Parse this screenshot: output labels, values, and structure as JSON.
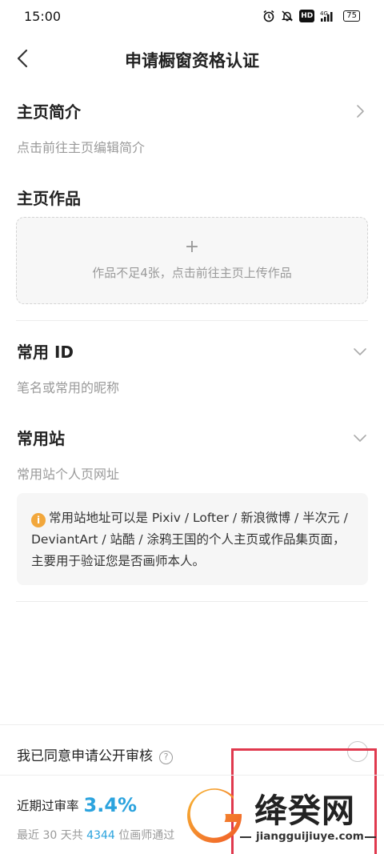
{
  "status_bar": {
    "time": "15:00",
    "network": "4G",
    "hd": "HD",
    "battery": "75"
  },
  "nav": {
    "title": "申请橱窗资格认证"
  },
  "homepage_intro": {
    "title": "主页简介",
    "subtitle": "点击前往主页编辑简介"
  },
  "homepage_works": {
    "title": "主页作品",
    "upload_plus": "+",
    "upload_hint": "作品不足4张，点击前往主页上传作品"
  },
  "common_id": {
    "title": "常用 ID",
    "placeholder": "笔名或常用的昵称"
  },
  "common_site": {
    "title": "常用站",
    "placeholder": "常用站个人页网址",
    "info_icon": "i",
    "info_text": "常用站地址可以是 Pixiv / Lofter / 新浪微博 / 半次元 / DeviantArt / 站酷 / 涂鸦王国的个人主页或作品集页面，主要用于验证您是否画师本人。"
  },
  "agreement": {
    "label": "我已同意申请公开审核",
    "help_icon": "?"
  },
  "stats": {
    "rate_label": "近期过审率",
    "rate_value": "3.4%",
    "stat_prefix": "最近 30 天共",
    "stat_count": "4344",
    "stat_suffix": "位画师通过"
  },
  "watermark": {
    "title": "绛癸网",
    "url": "jiangguijiuye.com"
  },
  "colors": {
    "accent_blue": "#2ba3de",
    "info_orange": "#f2a73b",
    "highlight_red": "#e0394e"
  },
  "icons": {
    "back": "back-arrow-icon",
    "chevron_right": "chevron-right-icon",
    "chevron_down": "chevron-down-icon",
    "info": "info-icon",
    "help": "help-circle-icon"
  }
}
